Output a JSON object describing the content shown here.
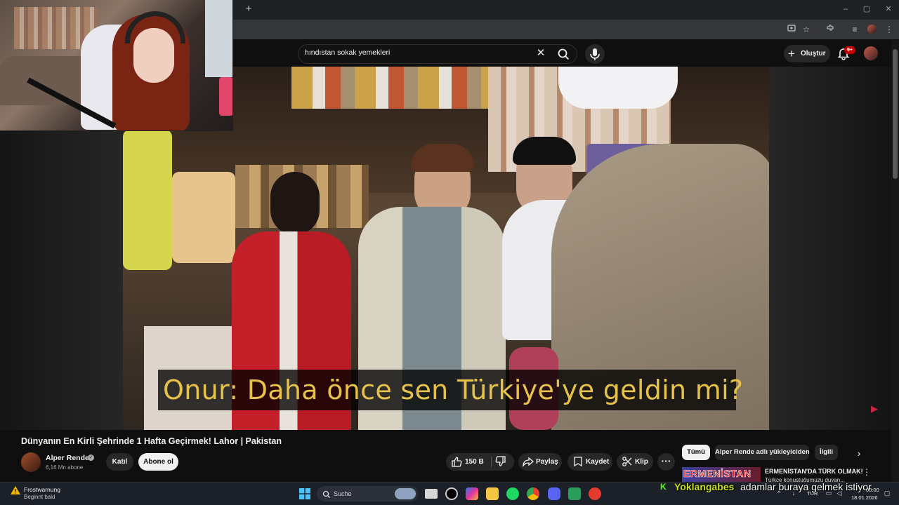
{
  "browser": {
    "new_tab_symbol": "+",
    "window_controls": [
      "–",
      "▢",
      "✕"
    ]
  },
  "youtube": {
    "search": {
      "query": "hındıstan sokak yemekleri",
      "clear_symbol": "✕"
    },
    "create_label": "Oluştur",
    "notifications_badge": "9+"
  },
  "video": {
    "subtitle": "Onur: Daha önce sen Türkiye'ye geldin mi?",
    "title": "Dünyanın En Kirli Şehrinde 1 Hafta Geçirmek! Lahor | Pakistan",
    "channel": {
      "name": "Alper Rende",
      "subscribers": "6,16 Mn abone"
    },
    "join_label": "Katıl",
    "subscribe_label": "Abone ol",
    "likes": "150 B",
    "share_label": "Paylaş",
    "save_label": "Kaydet",
    "clip_label": "Klip",
    "more_symbol": "···"
  },
  "related": {
    "chips": [
      "Tümü",
      "Alper Rende adlı yükleyiciden",
      "İlgili"
    ],
    "next_symbol": "›",
    "first_video": {
      "thumb_text": "ERMENİSTAN",
      "title": "ERMENİSTAN'DA TÜRK OLMAK!",
      "line2": "Türkçe konuştuğumuzu duyan..."
    }
  },
  "stream_chat": {
    "platform_icon": "K",
    "username": "Yoklangabes",
    "message": "adamlar buraya gelmek istiyor"
  },
  "taskbar": {
    "weather_title": "Frostwarnung",
    "weather_sub": "Beginnt bald",
    "search_placeholder": "Suche",
    "language": "TUR",
    "time": "00:00",
    "date": "18.01.2026"
  },
  "colors": {
    "accent_red": "#cc0000",
    "subtitle_yellow": "#e6c24a",
    "chat_username": "#c9e11f",
    "kick_green": "#53fc18"
  }
}
